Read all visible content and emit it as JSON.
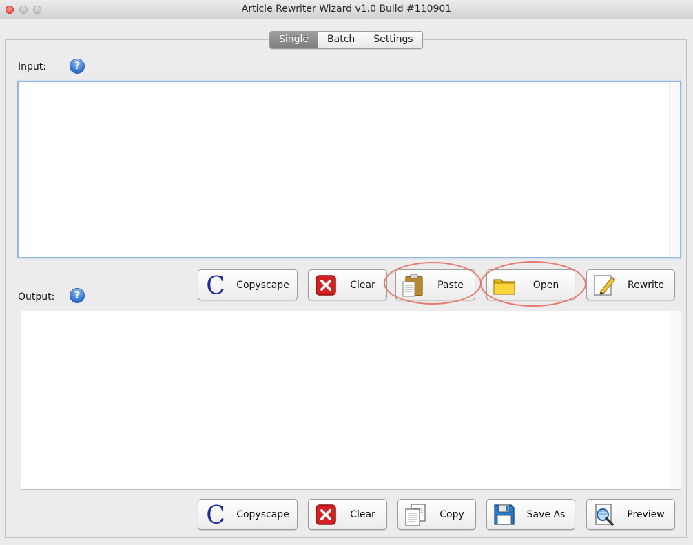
{
  "window": {
    "title": "Article Rewriter Wizard v1.0 Build #110901"
  },
  "tabs": [
    {
      "label": "Single",
      "active": true
    },
    {
      "label": "Batch",
      "active": false
    },
    {
      "label": "Settings",
      "active": false
    }
  ],
  "input": {
    "label": "Input:",
    "help": "?",
    "value": ""
  },
  "output": {
    "label": "Output:",
    "help": "?",
    "value": ""
  },
  "input_buttons": [
    {
      "label": "Copyscape",
      "icon": "copyscape-icon"
    },
    {
      "label": "Clear",
      "icon": "clear-icon"
    },
    {
      "label": "Paste",
      "icon": "clipboard-icon"
    },
    {
      "label": "Open",
      "icon": "folder-icon"
    },
    {
      "label": "Rewrite",
      "icon": "pencil-icon"
    }
  ],
  "output_buttons": [
    {
      "label": "Copyscape",
      "icon": "copyscape-icon"
    },
    {
      "label": "Clear",
      "icon": "clear-icon"
    },
    {
      "label": "Copy",
      "icon": "copy-documents-icon"
    },
    {
      "label": "Save As",
      "icon": "floppy-disk-icon"
    },
    {
      "label": "Preview",
      "icon": "magnifier-icon"
    }
  ],
  "colors": {
    "highlight_circle": "#e67a6e",
    "help_blue": "#2d6fd0",
    "clear_red": "#d42020",
    "copyscape_blue": "#1d2a9e",
    "active_tab": "#8c8c8c"
  }
}
